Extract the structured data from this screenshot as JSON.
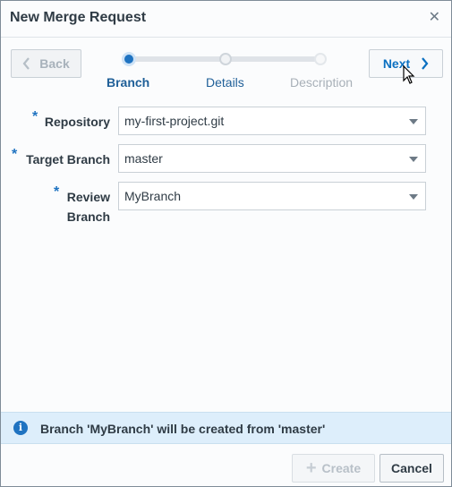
{
  "dialog": {
    "title": "New Merge Request",
    "close_icon": "close-icon"
  },
  "nav": {
    "back_label": "Back",
    "next_label": "Next"
  },
  "stepper": {
    "steps": [
      {
        "label": "Branch",
        "state": "active"
      },
      {
        "label": "Details",
        "state": "upcoming"
      },
      {
        "label": "Description",
        "state": "disabled"
      }
    ]
  },
  "form": {
    "required_mark": "*",
    "repository": {
      "label": "Repository",
      "value": "my-first-project.git"
    },
    "target_branch": {
      "label": "Target Branch",
      "value": "master"
    },
    "review_branch": {
      "label_line1": "Review",
      "label_line2": "Branch",
      "value": "MyBranch"
    }
  },
  "info": {
    "icon": "info-icon",
    "message": "Branch 'MyBranch' will be created from 'master'"
  },
  "footer": {
    "create_label": "Create",
    "cancel_label": "Cancel"
  },
  "colors": {
    "accent": "#1f73c1",
    "info_bg": "#ddeefb",
    "border": "#c9d0d6"
  }
}
